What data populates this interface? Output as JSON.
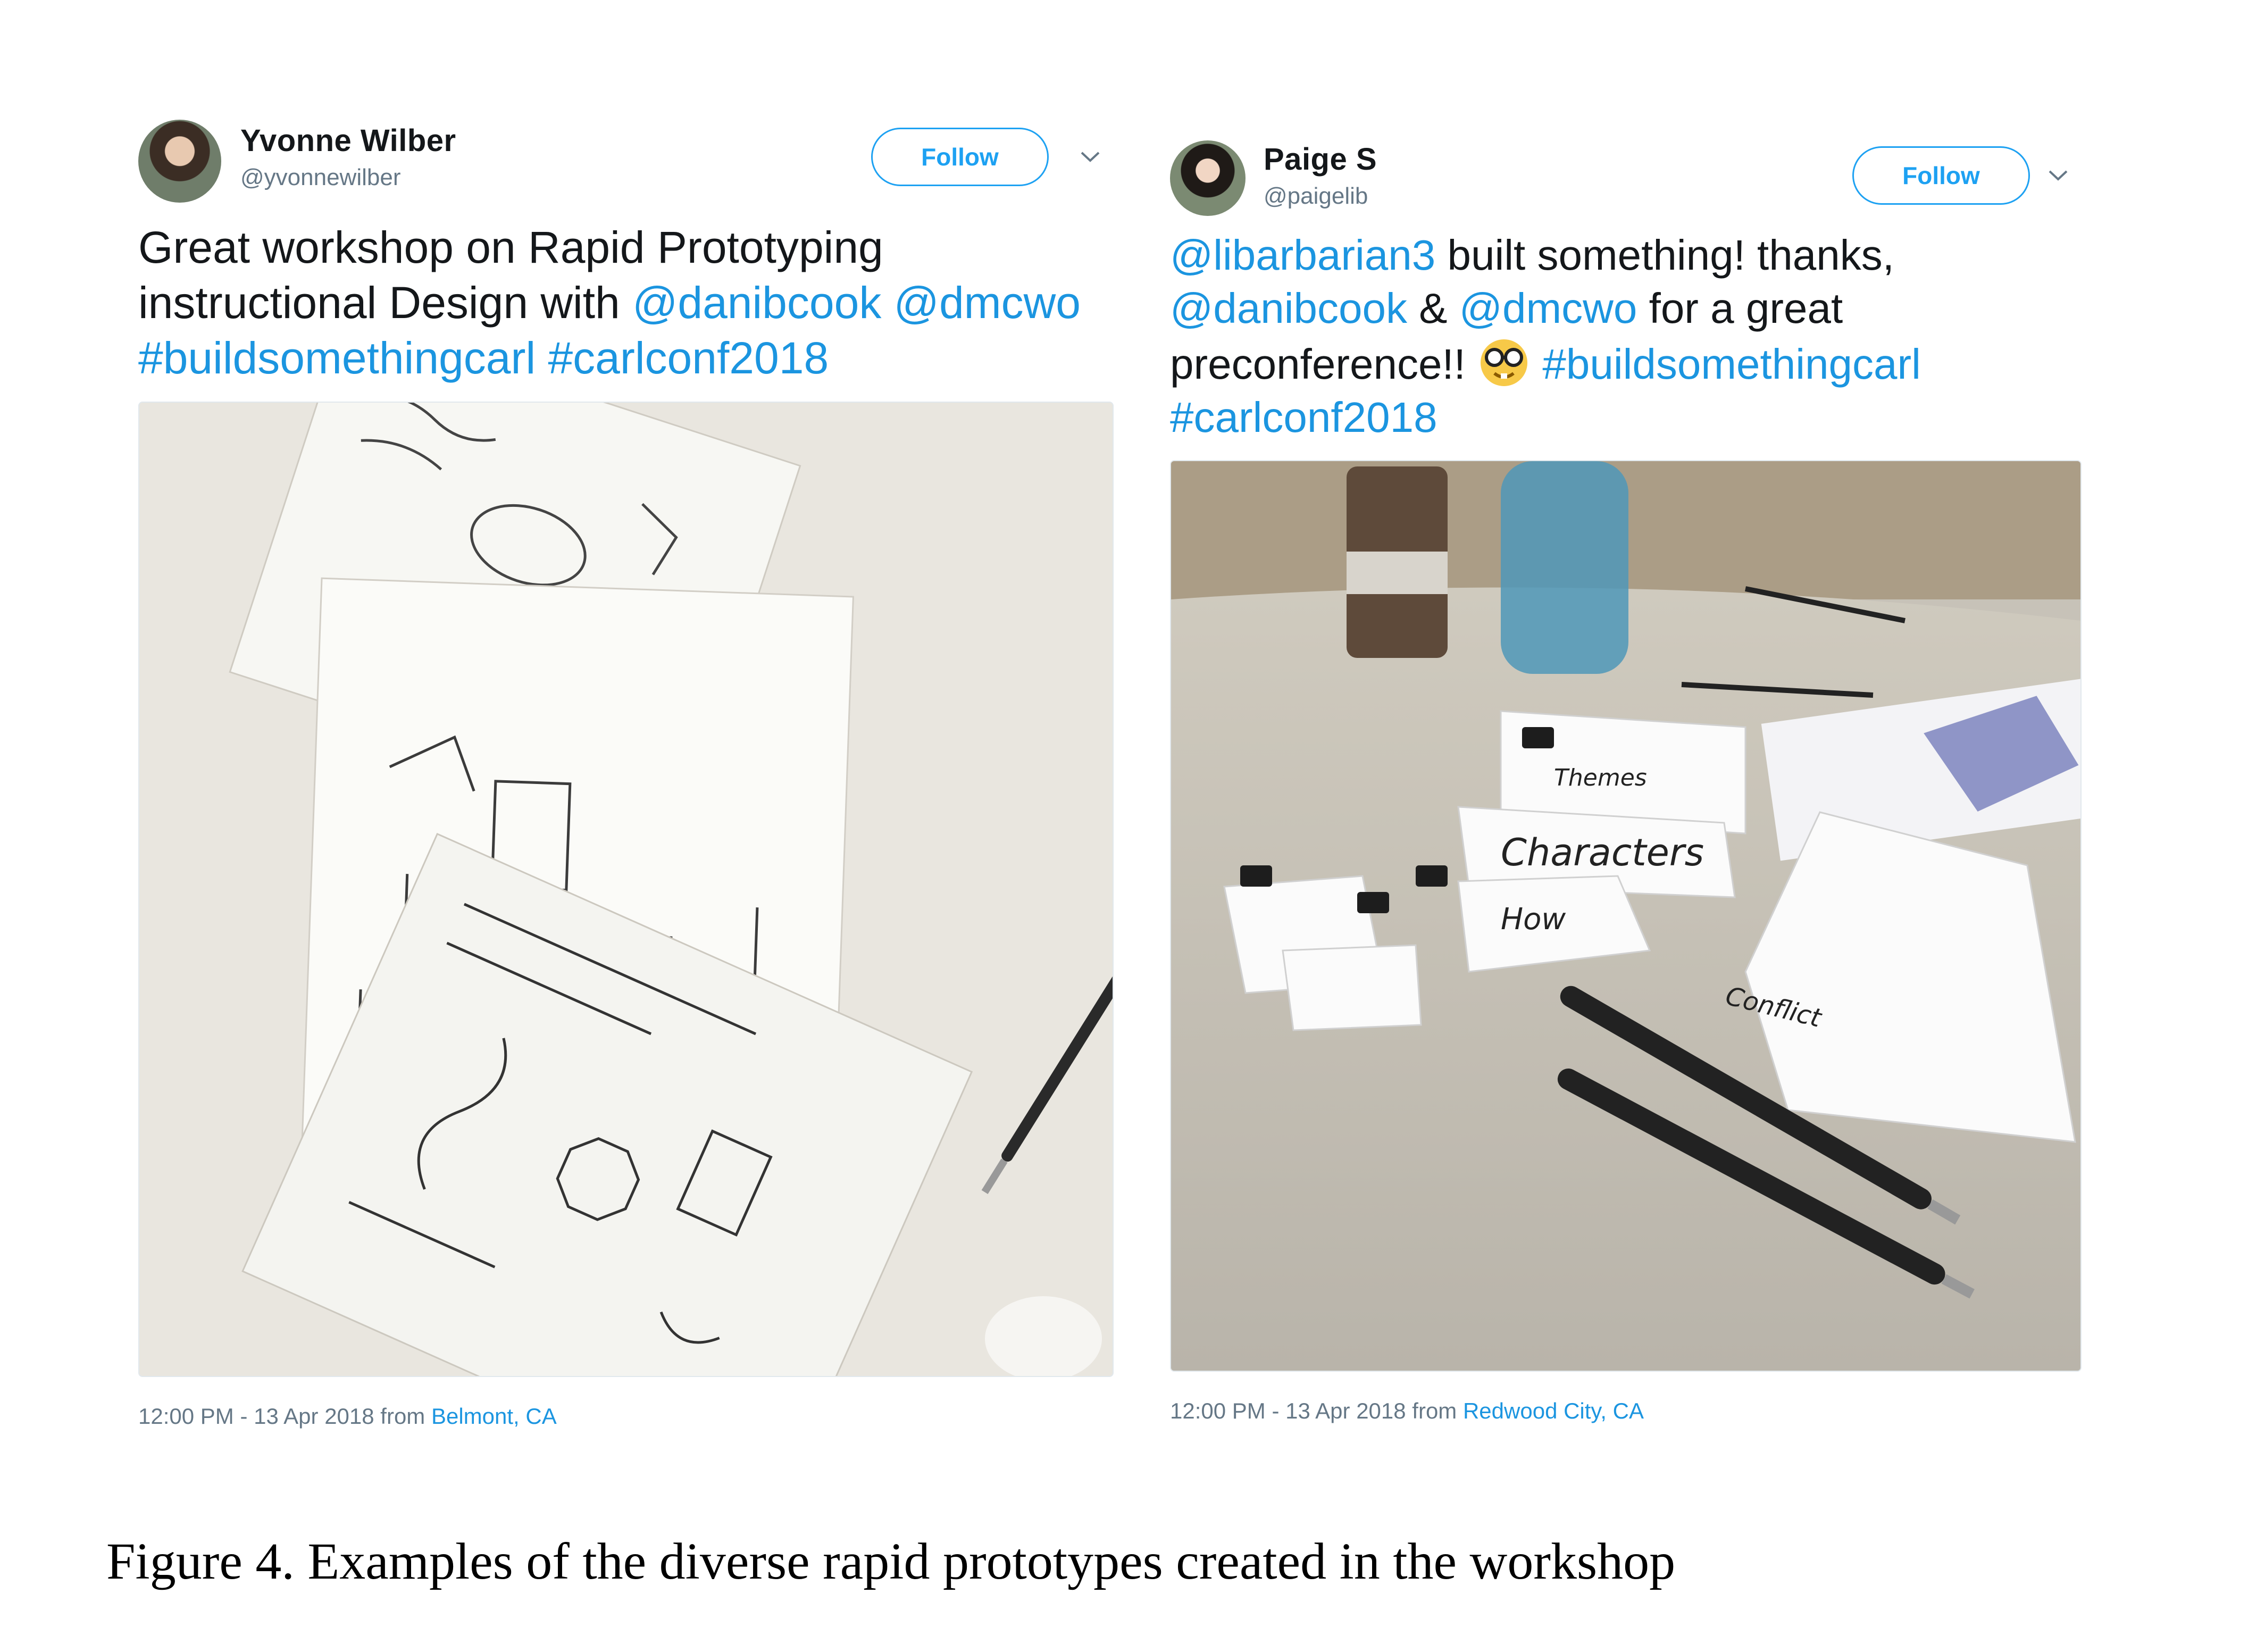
{
  "tweets": [
    {
      "name": "Yvonne Wilber",
      "handle": "@yvonnewilber",
      "follow_label": "Follow",
      "text_parts": [
        {
          "t": "Great workshop on Rapid Prototyping instructional Design with "
        },
        {
          "t": "@danibcook",
          "link": true
        },
        {
          "t": " "
        },
        {
          "t": "@dmcwo",
          "link": true
        },
        {
          "t": " "
        },
        {
          "t": "#buildsomethingcarl",
          "link": true
        },
        {
          "t": " "
        },
        {
          "t": "#carlconf2018",
          "link": true
        }
      ],
      "timestamp": "12:00 PM - 13 Apr 2018 from ",
      "location": "Belmont, CA",
      "photo_icon": "handwritten-worksheets-photo"
    },
    {
      "name": "Paige S",
      "handle": "@paigelib",
      "follow_label": "Follow",
      "text_parts": [
        {
          "t": "@libarbarian3",
          "link": true
        },
        {
          "t": " built something! thanks, "
        },
        {
          "t": "@danibcook",
          "link": true
        },
        {
          "t": " & "
        },
        {
          "t": "@dmcwo",
          "link": true
        },
        {
          "t": " for a great preconference!! "
        },
        {
          "emoji": "nerd-face"
        },
        {
          "t": " "
        },
        {
          "t": "#buildsomethingcarl",
          "link": true
        },
        {
          "t": " "
        },
        {
          "t": "#carlconf2018",
          "link": true
        }
      ],
      "timestamp": "12:00 PM - 13 Apr 2018 from ",
      "location": "Redwood City, CA",
      "photo_icon": "paper-prototype-boxes-photo",
      "photo_labels": [
        "Themes",
        "Characters",
        "How",
        "Conflict"
      ]
    }
  ],
  "caption": "Figure 4. Examples of the diverse rapid prototypes created in the workshop",
  "colors": {
    "link": "#1b95e0",
    "follow_border": "#1da1f2",
    "muted": "#657786"
  }
}
